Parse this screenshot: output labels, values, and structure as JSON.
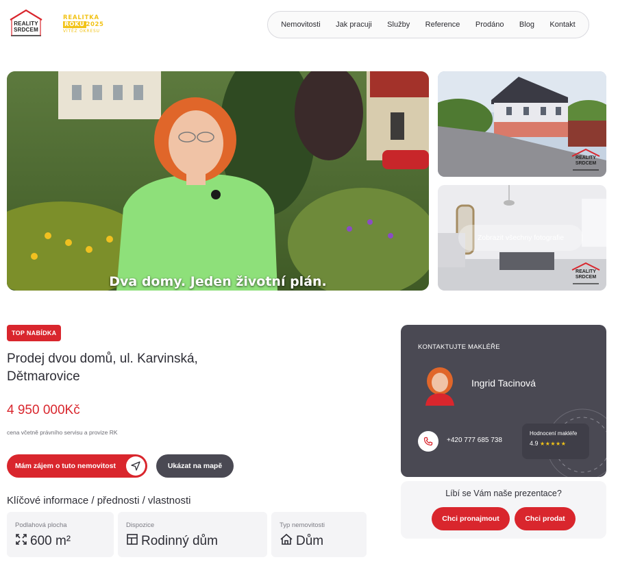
{
  "brand": {
    "logo_line1": "REALITY",
    "logo_line2": "SRDCEM",
    "award_line1": "REALITKA",
    "award_line2a": "ROKU",
    "award_line2b": "2025",
    "award_line3": "VÍTĚZ OKRESU",
    "accent": "#d9262d",
    "dark": "#4a4953",
    "gold": "#f2c318"
  },
  "nav": {
    "items": [
      "Nemovitosti",
      "Jak pracuji",
      "Služby",
      "Reference",
      "Prodáno",
      "Blog",
      "Kontakt"
    ]
  },
  "gallery": {
    "video_caption": "Dva domy. Jeden životní plán.",
    "show_all_label": "Zobrazit všechny fotografie",
    "watermark_line1": "REALITY",
    "watermark_line2": "SRDCEM"
  },
  "listing": {
    "badge": "TOP NABÍDKA",
    "title": "Prodej dvou domů, ul. Karvinská, Dětmarovice",
    "price": "4 950 000Kč",
    "price_note": "cena včetně právního servisu a provize RK",
    "interest_button": "Mám zájem o tuto nemovitost",
    "map_button": "Ukázat na mapě",
    "key_info_heading": "Klíčové informace / přednosti / vlastnosti",
    "properties": [
      {
        "label": "Podlahová plocha",
        "value": "600 m²",
        "icon": "area-icon"
      },
      {
        "label": "Dispozice",
        "value": "Rodinný dům",
        "icon": "layout-icon"
      },
      {
        "label": "Typ nemovitosti",
        "value": "Dům",
        "icon": "house-icon"
      }
    ]
  },
  "agent": {
    "heading": "KONTAKTUJTE MAKLÉŘE",
    "name": "Ingrid Tacinová",
    "phone": "+420 777 685 738",
    "rating_label": "Hodnocení makléře",
    "rating_value": "4.9",
    "rating_stars": 5
  },
  "cta": {
    "question": "Líbí se Vám naše prezentace?",
    "rent_button": "Chci pronajmout",
    "sell_button": "Chci prodat"
  }
}
